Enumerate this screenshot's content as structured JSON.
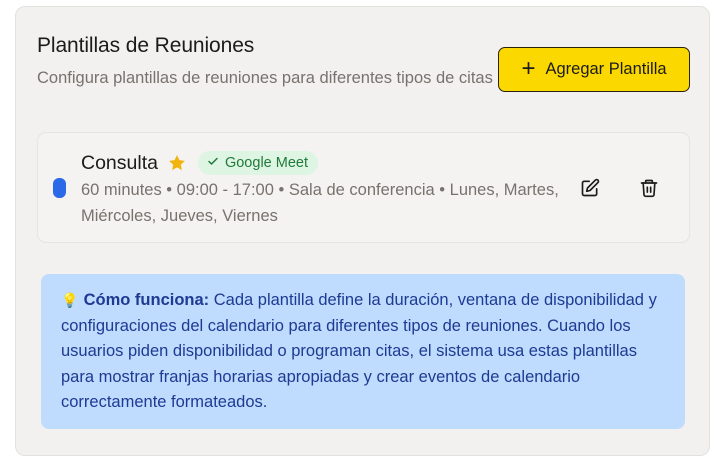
{
  "header": {
    "title": "Plantillas de Reuniones",
    "subtitle": "Configura plantillas de reuniones para diferentes tipos de citas",
    "add_button_label": "Agregar Plantilla",
    "add_button_icon": "plus-icon"
  },
  "templates": [
    {
      "name": "Consulta",
      "is_default": true,
      "badge": "Google Meet",
      "details": "60 minutes • 09:00 - 17:00 • Sala de conferencia • Lunes, Martes, Miércoles, Jueves, Viernes",
      "color": "#2a6ae8",
      "actions": [
        "edit-icon",
        "trash-icon"
      ]
    }
  ],
  "info": {
    "icon": "💡",
    "heading": "Cómo funciona:",
    "text": " Cada plantilla define la duración, ventana de disponibilidad y configuraciones del calendario para diferentes tipos de reuniones. Cuando los usuarios piden disponibilidad o programan citas, el sistema usa estas plantillas para mostrar franjas horarias apropiadas y crear eventos de calendario correctamente formateados."
  },
  "colors": {
    "accent": "#fbd900",
    "panel": "#f2f1f0",
    "info_bg": "#bfdbfd",
    "info_text": "#1e3a93",
    "badge_bg": "#dff5e3",
    "badge_text": "#1f7a3a",
    "star": "#f2b30c"
  }
}
